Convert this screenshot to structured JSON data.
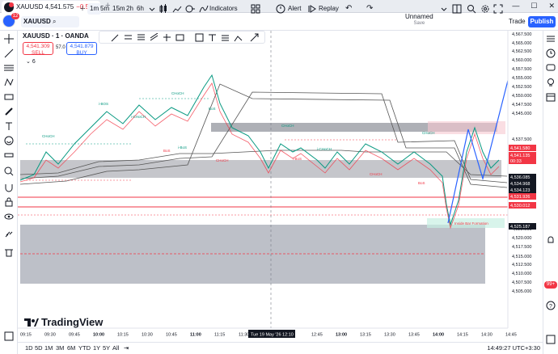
{
  "tab": {
    "symbol": "XAUUSD",
    "price": "4,541.575",
    "change": "−0.54%",
    "tail": "/ U",
    "close": "×",
    "new_tab": "+"
  },
  "window": {
    "minimize": "—",
    "maximize": "☐",
    "close": "✕"
  },
  "toolbar": {
    "symbol": "XAUUSD",
    "intervals": [
      "1m",
      "5m",
      "15m",
      "2h",
      "6h"
    ],
    "active_interval": "1m",
    "indicators_label": "Indicators",
    "alert_label": "Alert",
    "replay_label": "Replay",
    "layout_name": "Unnamed",
    "layout_status": "Save",
    "trade_label": "Trade",
    "publish_label": "Publish"
  },
  "legend": {
    "title": "XAUUSD · 1 · OANDA",
    "sell_price": "4,541.309",
    "sell_label": "SELL",
    "buy_price": "4,541.879",
    "buy_label": "BUY",
    "spread": "57.0",
    "indicator_count": "6"
  },
  "price_axis": {
    "labels": [
      "4,567.500",
      "4,565.000",
      "4,562.500",
      "4,560.000",
      "4,557.500",
      "4,555.000",
      "4,552.500",
      "4,550.000",
      "4,547.500",
      "4,545.000",
      "4,537.500",
      "4,527.500",
      "4,522.500",
      "4,520.000",
      "4,517.500",
      "4,515.000",
      "4,512.500",
      "4,510.000",
      "4,507.500",
      "4,505.000"
    ],
    "marks": [
      {
        "label": "4,541.580",
        "color": "#f23645"
      },
      {
        "label": "4,541.135",
        "color": "#f23645"
      },
      {
        "label": "00:33",
        "color": "#f23645"
      },
      {
        "label": "4,536.085",
        "color": "#131722"
      },
      {
        "label": "4,534.968",
        "color": "#131722"
      },
      {
        "label": "4,534.123",
        "color": "#131722"
      },
      {
        "label": "4,531.926",
        "color": "#f23645"
      },
      {
        "label": "4,530.012",
        "color": "#f23645"
      },
      {
        "label": "4,525.187",
        "color": "#131722"
      }
    ]
  },
  "time_axis": {
    "labels": [
      "09:15",
      "09:30",
      "09:45",
      "10:00",
      "10:15",
      "10:30",
      "10:45",
      "11:00",
      "11:15",
      "11:30",
      "11:45",
      "12:10",
      "12:45",
      "13:00",
      "13:15",
      "13:30",
      "13:45",
      "14:00",
      "14:15",
      "14:30",
      "14:45"
    ],
    "cursor_label": "Tue 19 May '26  12:10"
  },
  "annotations": {
    "chart_labels": [
      "CHoCH",
      "CHoCH",
      "i-BOS",
      "i-CHoCH",
      "CHoCH",
      "BoS",
      "i-CHoCH",
      "CHoCH",
      "i-BoS",
      "BoS",
      "i-BoS",
      "CHoCH",
      "CHoCH",
      "BoS",
      "Inside Bar Formation"
    ]
  },
  "ranges": [
    "1D",
    "5D",
    "1M",
    "3M",
    "6M",
    "YTD",
    "1Y",
    "5Y",
    "All"
  ],
  "clock": "14:49:27 UTC+3:30",
  "logo": "TradingView",
  "notification_count": "12",
  "side_badge": "99+",
  "colors": {
    "accent": "#2962ff",
    "up": "#089981",
    "down": "#f23645",
    "zone": "#b2b5be"
  }
}
